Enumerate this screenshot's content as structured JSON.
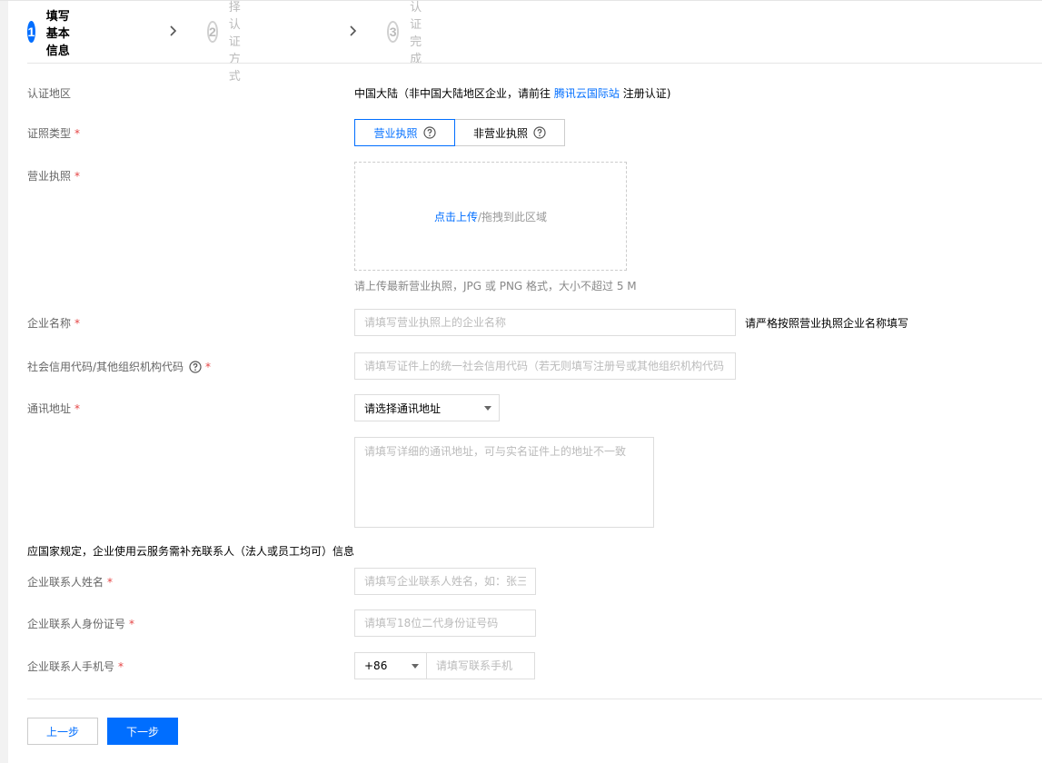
{
  "stepper": {
    "steps": [
      {
        "num": "1",
        "label": "填写基本信息"
      },
      {
        "num": "2",
        "label": "选择认证方式"
      },
      {
        "num": "3",
        "label": "认证完成"
      }
    ]
  },
  "region": {
    "label": "认证地区",
    "value_prefix": "中国大陆（非中国大陆地区企业，请前往",
    "link": "腾讯云国际站",
    "value_suffix": "注册认证)"
  },
  "cert_type": {
    "label": "证照类型",
    "required_mark": "*",
    "options": [
      "营业执照",
      "非营业执照"
    ],
    "selected": "营业执照"
  },
  "license": {
    "label": "营业执照",
    "required_mark": "*",
    "upload_link": "点击上传",
    "upload_rest": "/拖拽到此区域",
    "hint": "请上传最新营业执照，JPG 或 PNG 格式，大小不超过 5 M"
  },
  "company_name": {
    "label": "企业名称",
    "required_mark": "*",
    "placeholder": "请填写营业执照上的企业名称",
    "note": "请严格按照营业执照企业名称填写"
  },
  "credit_code": {
    "label": "社会信用代码/其他组织机构代码",
    "required_mark": "*",
    "placeholder": "请填写证件上的统一社会信用代码（若无则填写注册号或其他组织机构代码"
  },
  "address": {
    "label": "通讯地址",
    "required_mark": "*",
    "select_value": "请选择通讯地址",
    "detail_placeholder": "请填写详细的通讯地址，可与实名证件上的地址不一致"
  },
  "contact_notice": "应国家规定，企业使用云服务需补充联系人（法人或员工均可）信息",
  "contact_name": {
    "label": "企业联系人姓名",
    "required_mark": "*",
    "placeholder": "请填写企业联系人姓名，如：张三"
  },
  "contact_id": {
    "label": "企业联系人身份证号",
    "required_mark": "*",
    "placeholder": "请填写18位二代身份证号码"
  },
  "contact_phone": {
    "label": "企业联系人手机号",
    "required_mark": "*",
    "country_code": "+86",
    "placeholder": "请填写联系手机"
  },
  "actions": {
    "prev_label": "上一步",
    "next_label": "下一步"
  },
  "colors": {
    "accent": "#006eff",
    "required": "#e54545"
  }
}
